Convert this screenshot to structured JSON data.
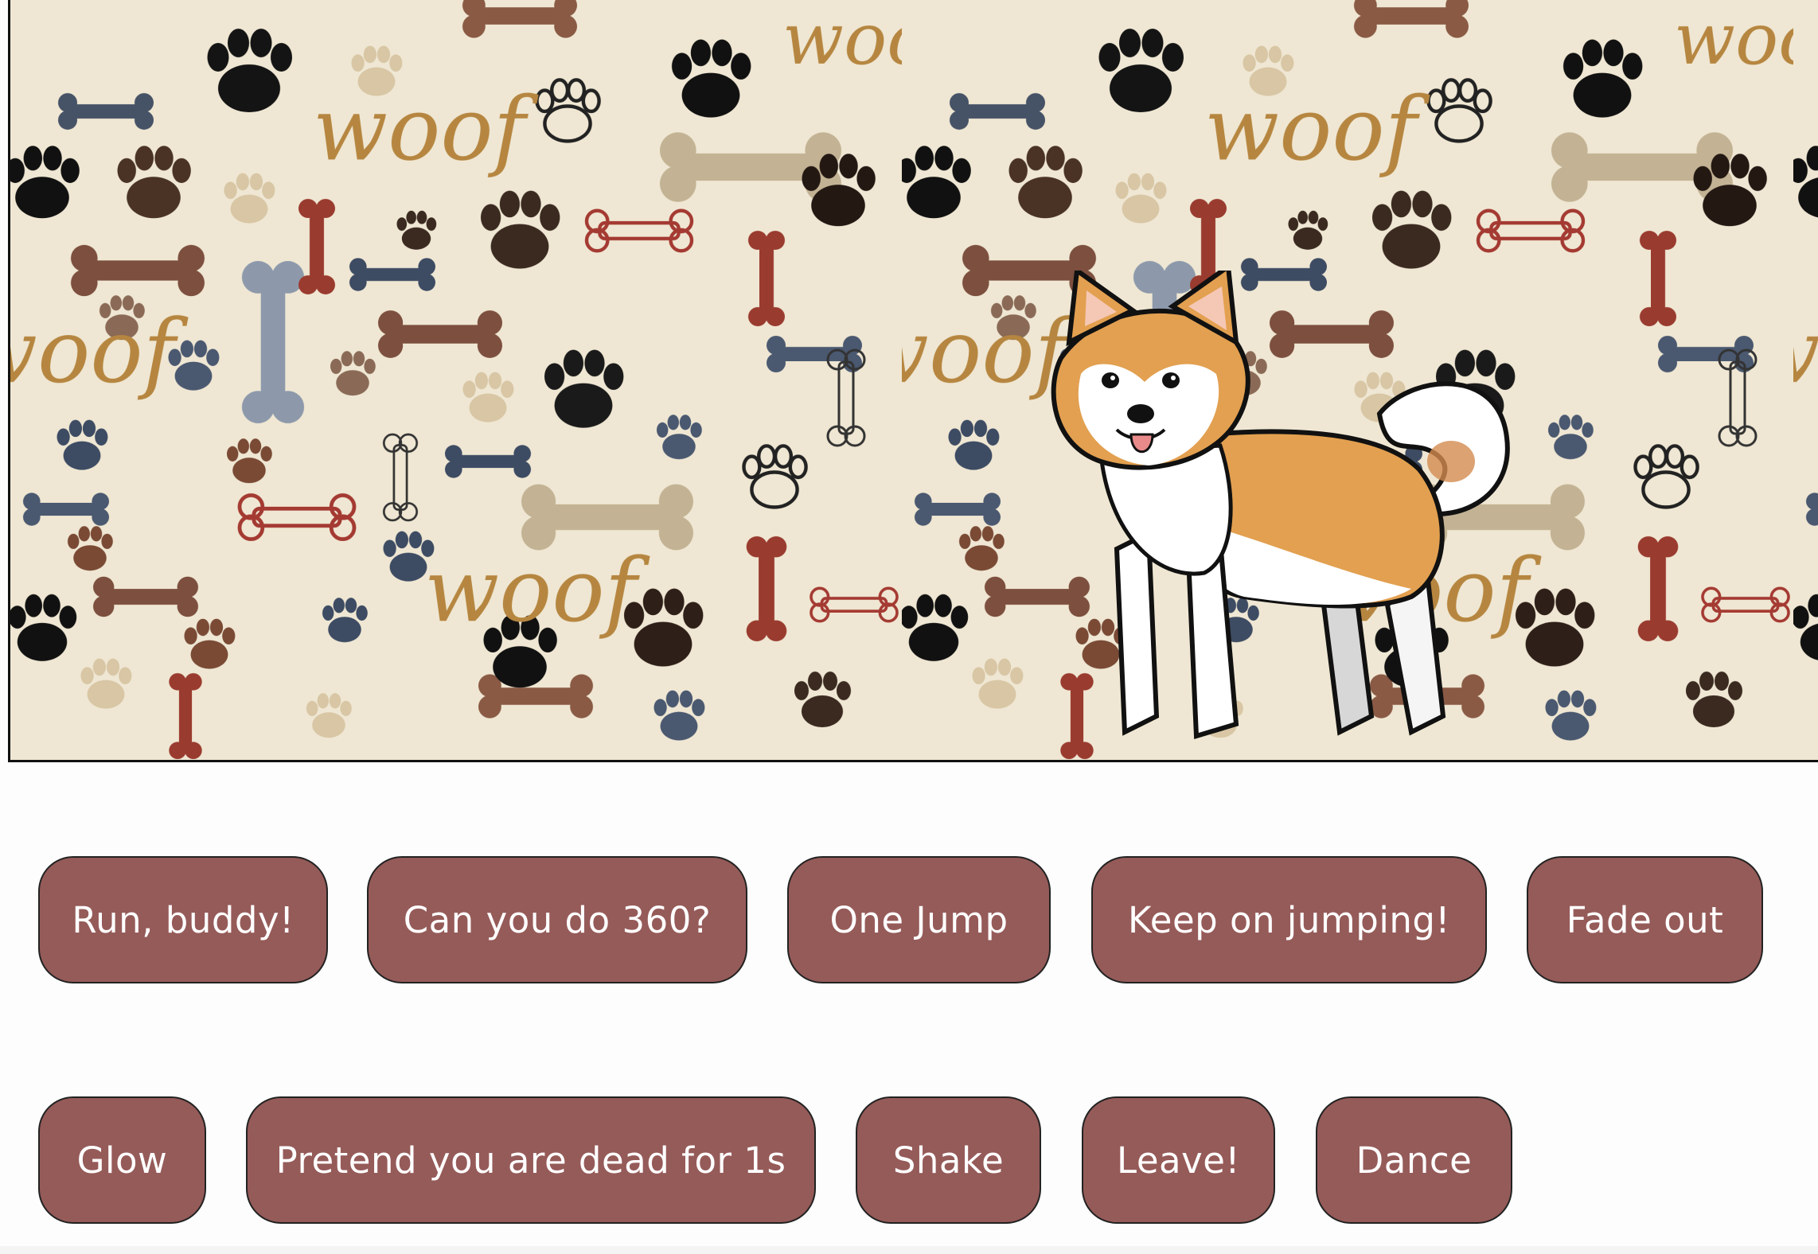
{
  "stage": {
    "background_pattern": "dog-paw-and-bone-pattern",
    "pattern_text": "woof",
    "character": "akita-dog-cartoon"
  },
  "colors": {
    "button_bg": "#955b59",
    "button_text": "#ffffff",
    "pattern_bg": "#efe7d3"
  },
  "buttons_row1": [
    {
      "label": "Run, buddy!"
    },
    {
      "label": "Can you do 360?"
    },
    {
      "label": "One Jump"
    },
    {
      "label": "Keep on jumping!"
    },
    {
      "label": "Fade out"
    }
  ],
  "buttons_row2": [
    {
      "label": "Glow"
    },
    {
      "label": "Pretend you are dead for 1s"
    },
    {
      "label": "Shake"
    },
    {
      "label": "Leave!"
    },
    {
      "label": "Dance"
    }
  ]
}
